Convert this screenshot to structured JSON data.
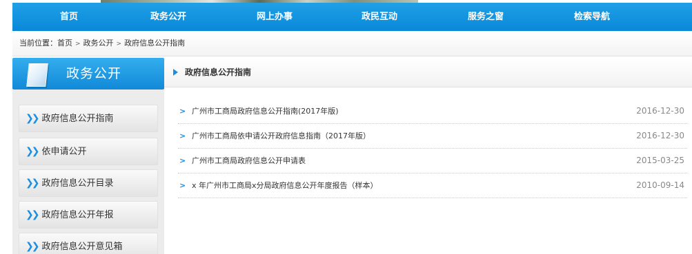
{
  "nav": {
    "items": [
      {
        "label": "首页"
      },
      {
        "label": "政务公开"
      },
      {
        "label": "网上办事"
      },
      {
        "label": "政民互动"
      },
      {
        "label": "服务之窗"
      },
      {
        "label": "检索导航"
      }
    ]
  },
  "breadcrumb": {
    "prefix": "当前位置：",
    "items": [
      "首页",
      "政务公开",
      "政府信息公开指南"
    ],
    "separator": ">"
  },
  "sidebar": {
    "title": "政务公开",
    "items": [
      {
        "label": "政府信息公开指南"
      },
      {
        "label": "依申请公开"
      },
      {
        "label": "政府信息公开目录"
      },
      {
        "label": "政府信息公开年报"
      },
      {
        "label": "政府信息公开意见箱"
      }
    ]
  },
  "content": {
    "title": "政府信息公开指南",
    "rows": [
      {
        "title": "广州市工商局政府信息公开指南(2017年版)",
        "date": "2016-12-30"
      },
      {
        "title": "广州市工商局依申请公开政府信息指南（2017年版）",
        "date": "2016-12-30"
      },
      {
        "title": "广州市工商局政府信息公开申请表",
        "date": "2015-03-25"
      },
      {
        "title": "x 年广州市工商局x分局政府信息公开年度报告（样本）",
        "date": "2010-09-14"
      }
    ]
  },
  "colors": {
    "nav_blue": "#0a88d8",
    "accent_blue": "#1a8ee0",
    "date_gray": "#888888"
  },
  "icons": {
    "sidebar_header": "document-page-icon",
    "sidebar_item": "double-chevron-right-icon",
    "content_header": "triangle-right-icon",
    "row_bullet": "chevron-right-icon",
    "breadcrumb_separator": "chevron-right-icon"
  }
}
